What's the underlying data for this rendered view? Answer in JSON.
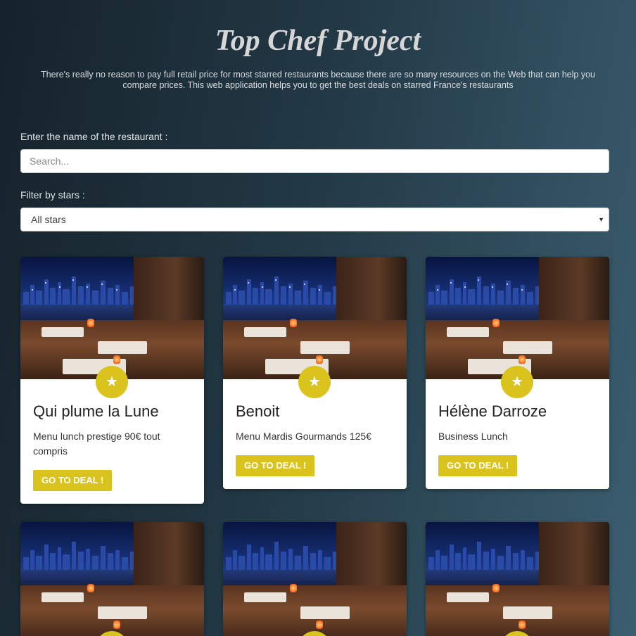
{
  "header": {
    "title": "Top Chef Project",
    "tagline_line1": "There's really no reason to pay full retail price for most starred restaurants because there are so many resources on the Web that can help you",
    "tagline_line2": "compare prices. This web application helps you to get the best deals on starred France's restaurants"
  },
  "search": {
    "label": "Enter the name of the restaurant :",
    "placeholder": "Search...",
    "value": ""
  },
  "filter": {
    "label": "Filter by stars :",
    "selected": "All stars"
  },
  "cards": [
    {
      "name": "Qui plume la Lune",
      "description": "Menu lunch prestige 90€ tout compris",
      "button": "GO TO DEAL !",
      "icon": "star-icon"
    },
    {
      "name": "Benoit",
      "description": "Menu Mardis Gourmands 125€",
      "button": "GO TO DEAL !",
      "icon": "star-icon"
    },
    {
      "name": "Hélène Darroze",
      "description": "Business Lunch",
      "button": "GO TO DEAL !",
      "icon": "star-icon"
    }
  ],
  "colors": {
    "accent": "#d9c31c",
    "background_dark": "#16222b",
    "background_light": "#3b5e70"
  }
}
